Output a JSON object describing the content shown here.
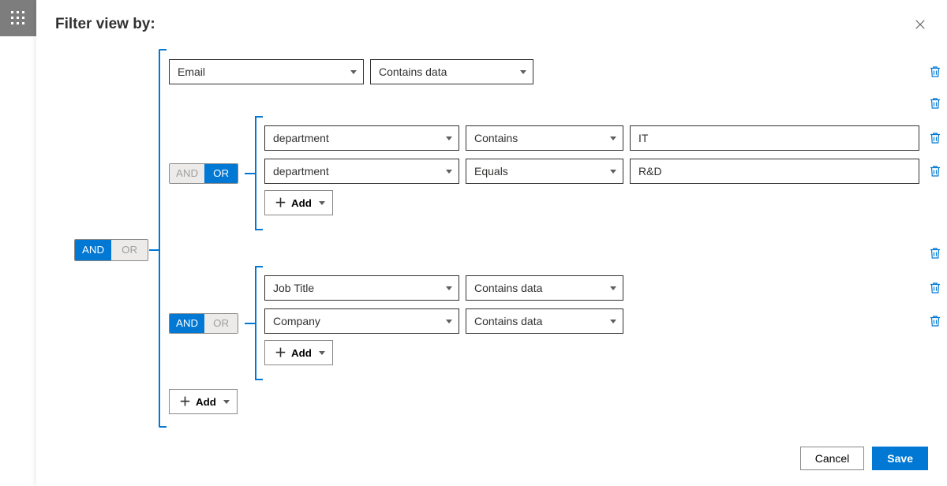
{
  "title": "Filter view by:",
  "logic": {
    "and": "AND",
    "or": "OR"
  },
  "add_label": "Add",
  "footer": {
    "cancel": "Cancel",
    "save": "Save"
  },
  "root": {
    "op": "AND",
    "row1": {
      "field": "Email",
      "operator": "Contains data"
    },
    "group1": {
      "op": "OR",
      "rows": [
        {
          "field": "department",
          "operator": "Contains",
          "value": "IT"
        },
        {
          "field": "department",
          "operator": "Equals",
          "value": "R&D"
        }
      ]
    },
    "group2": {
      "op": "AND",
      "rows": [
        {
          "field": "Job Title",
          "operator": "Contains data"
        },
        {
          "field": "Company",
          "operator": "Contains data"
        }
      ]
    }
  }
}
